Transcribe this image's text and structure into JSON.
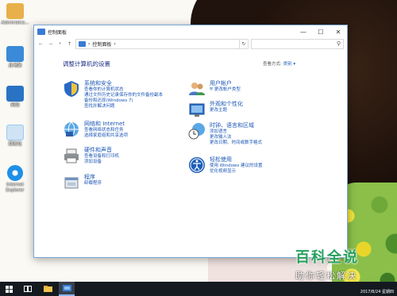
{
  "desktop": {
    "icons": [
      {
        "label": "Administra...",
        "icon": "user-folder-icon",
        "color": "#e8b04a"
      },
      {
        "label": "此电脑",
        "icon": "this-pc-icon",
        "color": "#3b8ad8"
      },
      {
        "label": "网络",
        "icon": "network-icon",
        "color": "#2a73c4"
      },
      {
        "label": "回收站",
        "icon": "recycle-bin-icon",
        "color": "#9cc8ee"
      },
      {
        "label": "Internet Explorer",
        "icon": "ie-icon",
        "color": "#1e90e6"
      }
    ]
  },
  "window": {
    "title": "控制面板",
    "controls": {
      "minimize": "—",
      "maximize": "☐",
      "close": "✕"
    },
    "address": {
      "path": "控制面板",
      "separator": "›"
    },
    "heading": "调整计算机的设置",
    "view_by": {
      "label": "查看方式:",
      "value": "类别"
    },
    "categories": [
      {
        "title": "系统和安全",
        "icon": "shield-icon",
        "links": [
          "查看你的计算机状态",
          "通过文件历史记录保存你的文件备份副本",
          "备份和还原(Windows 7)",
          "查找并解决问题"
        ]
      },
      {
        "title": "网络和 Internet",
        "icon": "network-globe-icon",
        "links": [
          "查看网络状态和任务",
          "选择家庭组和共享选项"
        ]
      },
      {
        "title": "硬件和声音",
        "icon": "printer-icon",
        "links": [
          "查看设备和打印机",
          "添加设备"
        ]
      },
      {
        "title": "程序",
        "icon": "programs-icon",
        "links": [
          "卸载程序"
        ]
      },
      {
        "title": "用户帐户",
        "icon": "users-icon",
        "links": [
          "更改帐户类型"
        ]
      },
      {
        "title": "外观和个性化",
        "icon": "appearance-icon",
        "links": [
          "更改主题"
        ]
      },
      {
        "title": "时钟、语言和区域",
        "icon": "clock-globe-icon",
        "links": [
          "添加语言",
          "更改输入法",
          "更改日期、时间或数字格式"
        ]
      },
      {
        "title": "轻松使用",
        "icon": "ease-of-access-icon",
        "links": [
          "使用 Windows 建议的设置",
          "优化视频显示"
        ]
      }
    ]
  },
  "taskbar": {
    "items": [
      "start-icon",
      "task-view-icon",
      "file-explorer-icon",
      "control-panel-icon"
    ],
    "date": "2017/8/24 星期四"
  },
  "watermark": {
    "line1": "百科全说",
    "line2": "助你轻松解决"
  }
}
